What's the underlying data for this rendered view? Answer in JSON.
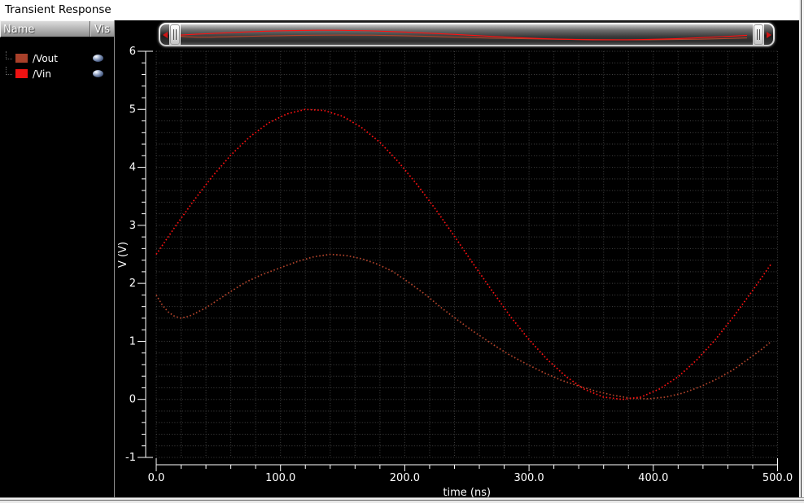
{
  "window": {
    "title": "Transient Response"
  },
  "legend": {
    "columns": {
      "name": "Name",
      "vis": "Vis"
    },
    "signals": [
      {
        "name": "/Vout",
        "color": "#a8402a",
        "visible": true,
        "vis_icon": "eye-icon"
      },
      {
        "name": "/Vin",
        "color": "#ee1212",
        "visible": true,
        "vis_icon": "eye-icon"
      }
    ]
  },
  "scrollbar": {
    "left_icon": "arrow-left",
    "right_icon": "arrow-right",
    "description": "horizontal zoom range slider with waveform preview"
  },
  "chart_data": {
    "type": "line",
    "title": "Transient Response",
    "xlabel": "time (ns)",
    "ylabel": "V (V)",
    "xlim": [
      0,
      500
    ],
    "ylim": [
      -1,
      6
    ],
    "x_ticks": [
      0,
      100,
      200,
      300,
      400,
      500
    ],
    "x_tick_labels": [
      "0.0",
      "100.0",
      "200.0",
      "300.0",
      "400.0",
      "500.0"
    ],
    "y_ticks": [
      -1,
      0,
      1,
      2,
      3,
      4,
      5,
      6
    ],
    "y_tick_labels": [
      "-1",
      "0",
      "1",
      "2",
      "3",
      "4",
      "5",
      "6"
    ],
    "x_minor_step": 20,
    "y_minor_step": 0.2,
    "grid": "dotted",
    "grid_color": "#424242",
    "axis_color": "#ffffff",
    "background": "#000000",
    "line_style": "dotted",
    "series": [
      {
        "name": "/Vout",
        "color": "#b4452c",
        "points": [
          [
            0,
            1.8
          ],
          [
            5,
            1.62
          ],
          [
            10,
            1.5
          ],
          [
            15,
            1.43
          ],
          [
            20,
            1.4
          ],
          [
            26,
            1.43
          ],
          [
            32,
            1.49
          ],
          [
            40,
            1.58
          ],
          [
            50,
            1.72
          ],
          [
            60,
            1.86
          ],
          [
            72,
            2.02
          ],
          [
            85,
            2.15
          ],
          [
            100,
            2.27
          ],
          [
            114,
            2.38
          ],
          [
            127,
            2.46
          ],
          [
            140,
            2.5
          ],
          [
            153,
            2.48
          ],
          [
            166,
            2.42
          ],
          [
            178,
            2.33
          ],
          [
            190,
            2.21
          ],
          [
            203,
            2.02
          ],
          [
            217,
            1.8
          ],
          [
            230,
            1.57
          ],
          [
            243,
            1.36
          ],
          [
            256,
            1.16
          ],
          [
            270,
            0.96
          ],
          [
            284,
            0.77
          ],
          [
            298,
            0.61
          ],
          [
            312,
            0.46
          ],
          [
            326,
            0.33
          ],
          [
            340,
            0.23
          ],
          [
            354,
            0.14
          ],
          [
            368,
            0.07
          ],
          [
            382,
            0.02
          ],
          [
            396,
            0.01
          ],
          [
            410,
            0.04
          ],
          [
            424,
            0.11
          ],
          [
            438,
            0.22
          ],
          [
            452,
            0.36
          ],
          [
            465,
            0.52
          ],
          [
            478,
            0.72
          ],
          [
            487,
            0.86
          ],
          [
            495,
            1.0
          ]
        ]
      },
      {
        "name": "/Vin",
        "color": "#ff1212",
        "points": [
          [
            0,
            2.5
          ],
          [
            15,
            2.97
          ],
          [
            30,
            3.42
          ],
          [
            45,
            3.84
          ],
          [
            60,
            4.21
          ],
          [
            75,
            4.52
          ],
          [
            90,
            4.76
          ],
          [
            105,
            4.92
          ],
          [
            120,
            5.0
          ],
          [
            135,
            4.98
          ],
          [
            150,
            4.88
          ],
          [
            165,
            4.69
          ],
          [
            180,
            4.43
          ],
          [
            195,
            4.09
          ],
          [
            210,
            3.7
          ],
          [
            225,
            3.27
          ],
          [
            240,
            2.81
          ],
          [
            255,
            2.34
          ],
          [
            270,
            1.88
          ],
          [
            285,
            1.43
          ],
          [
            300,
            1.03
          ],
          [
            315,
            0.68
          ],
          [
            330,
            0.39
          ],
          [
            345,
            0.17
          ],
          [
            360,
            0.04
          ],
          [
            375,
            0.0
          ],
          [
            390,
            0.04
          ],
          [
            405,
            0.18
          ],
          [
            420,
            0.39
          ],
          [
            435,
            0.68
          ],
          [
            450,
            1.03
          ],
          [
            465,
            1.44
          ],
          [
            480,
            1.88
          ],
          [
            495,
            2.34
          ]
        ]
      }
    ]
  }
}
